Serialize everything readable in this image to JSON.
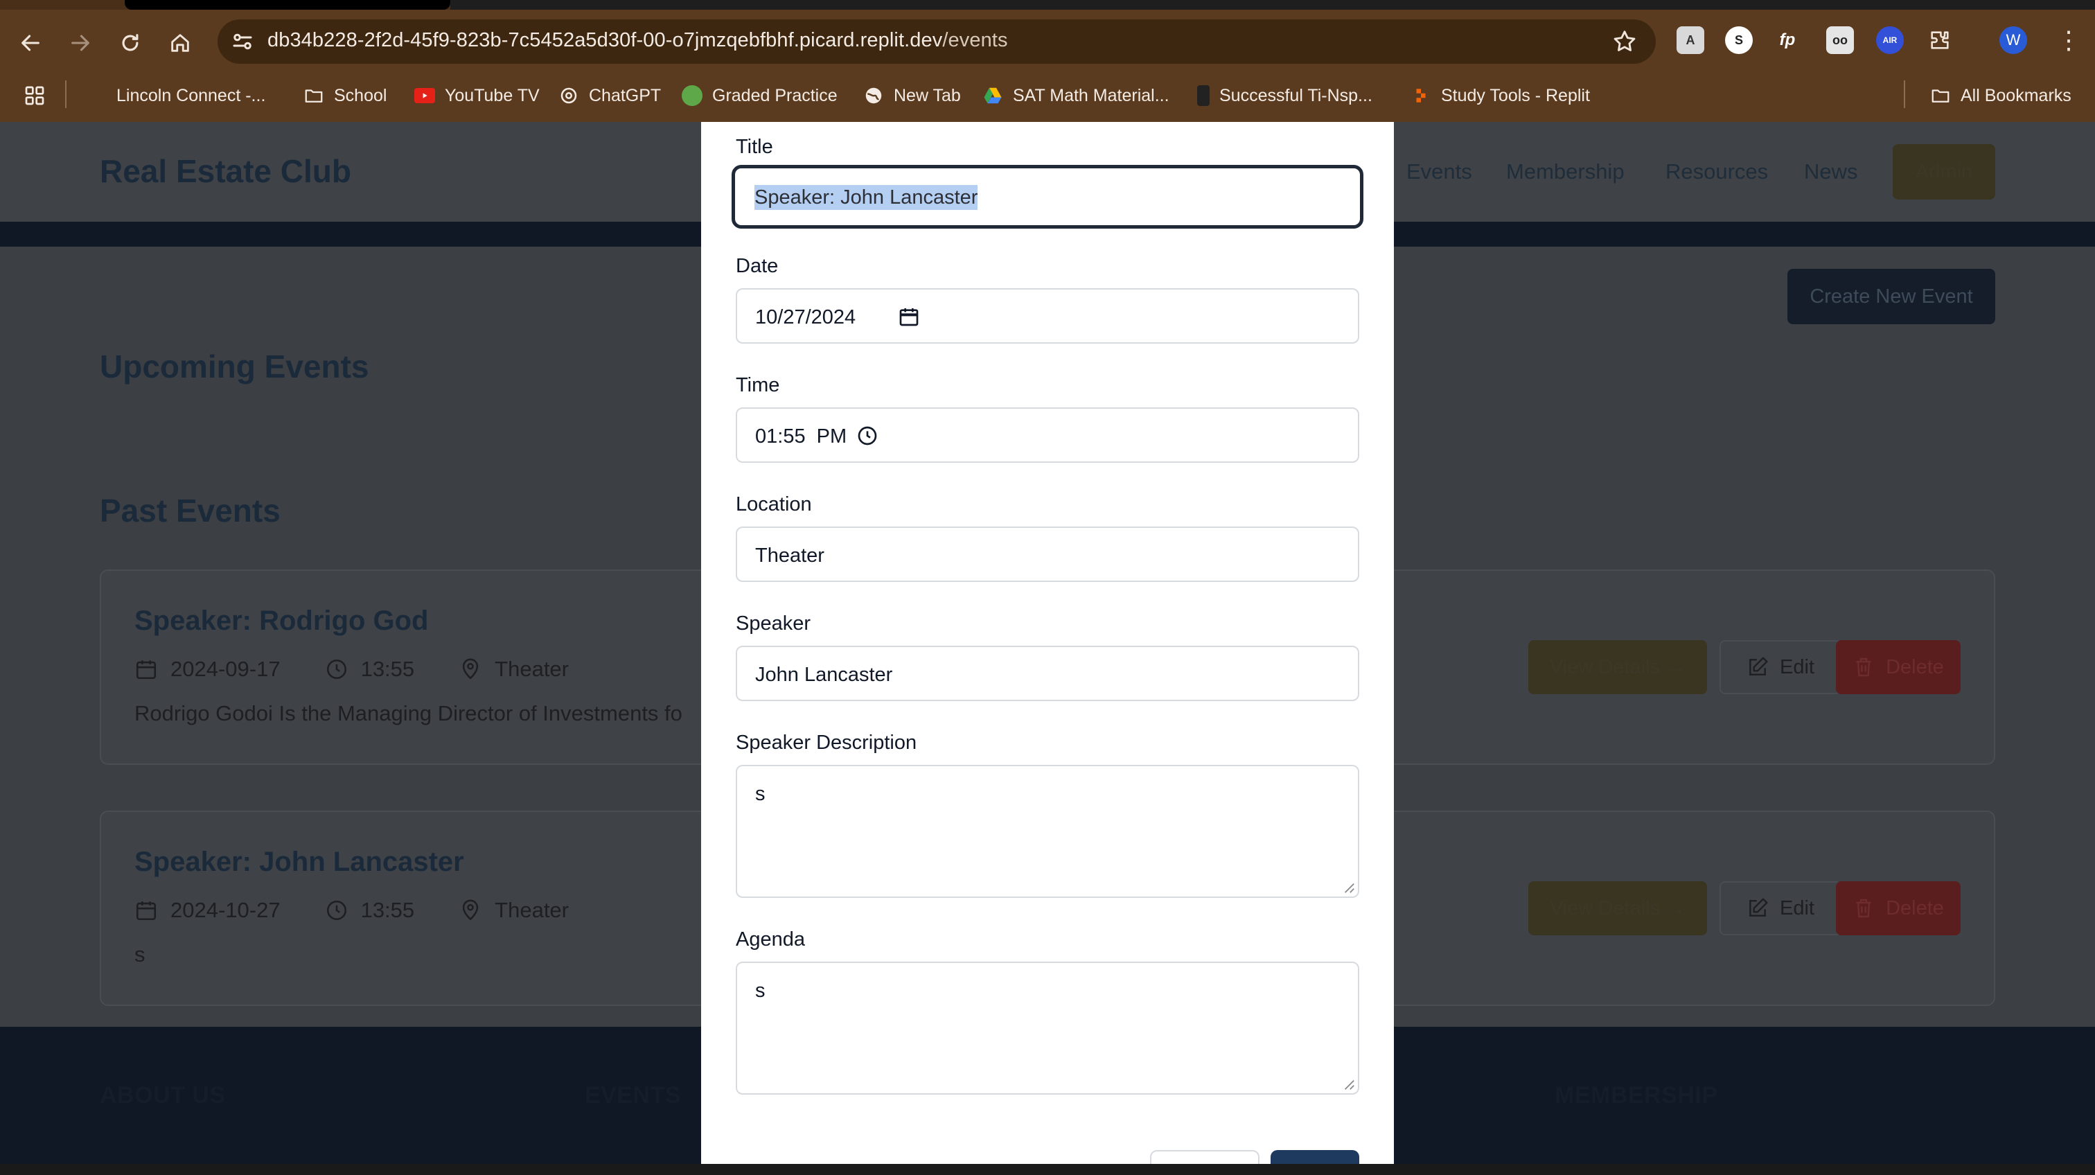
{
  "browser": {
    "url_host": "db34b228-2f2d-45f9-823b-7c5452a5d30f-00-o7jmzqebfbhf.picard.replit.dev",
    "url_path": "/events",
    "profile_initial": "W",
    "bookmarks": [
      {
        "label": "Lincoln Connect -...",
        "icon": "microsoft-icon"
      },
      {
        "label": "School",
        "icon": "folder-icon"
      },
      {
        "label": "YouTube TV",
        "icon": "youtube-icon"
      },
      {
        "label": "ChatGPT",
        "icon": "openai-icon"
      },
      {
        "label": "Graded Practice",
        "icon": "frog-icon"
      },
      {
        "label": "New Tab",
        "icon": "globe-icon"
      },
      {
        "label": "SAT Math Material...",
        "icon": "drive-icon"
      },
      {
        "label": "Successful Ti-Nsp...",
        "icon": "calculator-icon"
      },
      {
        "label": "Study Tools - Replit",
        "icon": "replit-icon"
      }
    ],
    "all_bookmarks": "All Bookmarks"
  },
  "site": {
    "brand": "Real Estate Club",
    "nav": [
      "Events",
      "Membership",
      "Resources",
      "News"
    ],
    "admin": "Admin",
    "create_event": "Create New Event",
    "upcoming_title": "Upcoming Events",
    "past_title": "Past Events",
    "events": [
      {
        "title": "Speaker: Rodrigo God",
        "date": "2024-09-17",
        "time": "13:55",
        "location": "Theater",
        "description": "Rodrigo Godoi Is the Managing Director of Investments fo",
        "view": "View Details →",
        "edit": "Edit",
        "delete": "Delete"
      },
      {
        "title": "Speaker: John Lancaster",
        "date": "2024-10-27",
        "time": "13:55",
        "location": "Theater",
        "description": "s",
        "view": "View Details →",
        "edit": "Edit",
        "delete": "Delete"
      }
    ],
    "footer": [
      "ABOUT US",
      "EVENTS",
      "MEMBERSHIP"
    ]
  },
  "modal": {
    "title_label": "Title",
    "title_value": "Speaker: John Lancaster",
    "date_label": "Date",
    "date_value": "10/27/2024",
    "time_label": "Time",
    "time_value": "01:55  PM",
    "location_label": "Location",
    "location_value": "Theater",
    "speaker_label": "Speaker",
    "speaker_value": "John Lancaster",
    "speaker_desc_label": "Speaker Description",
    "speaker_desc_value": "s",
    "agenda_label": "Agenda",
    "agenda_value": "s"
  },
  "colors": {
    "overlay_page_bg": "#3c3f43",
    "chrome_bg": "#5b3b1f",
    "modal_bg": "#ffffff",
    "selection": "#b5cff2"
  }
}
